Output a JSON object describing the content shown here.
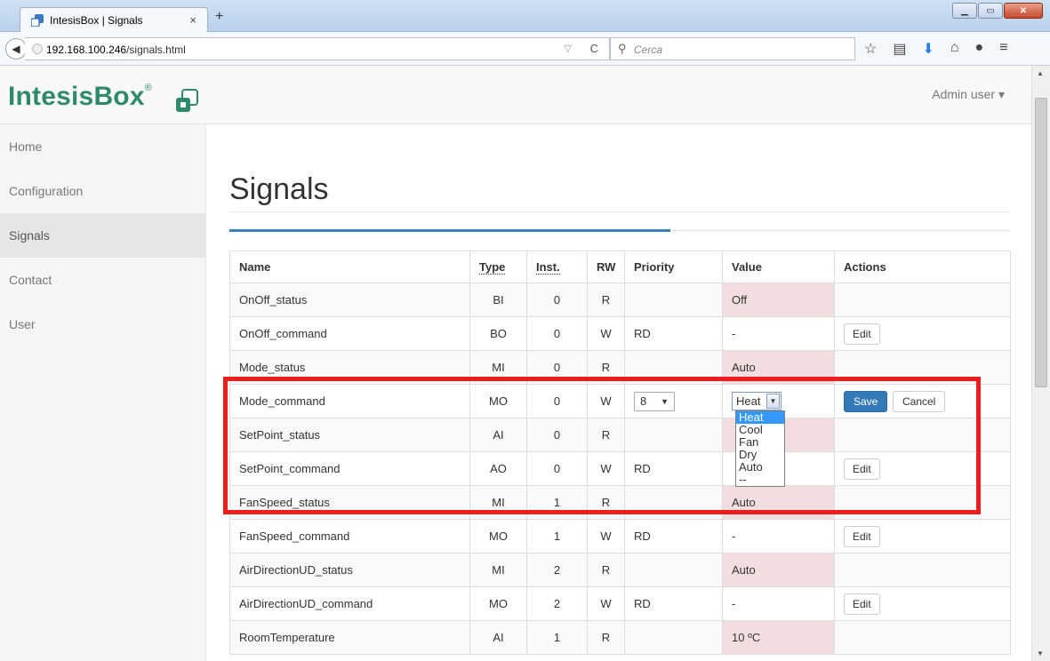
{
  "browser": {
    "tab_title": "IntesisBox | Signals",
    "tab_close": "×",
    "new_tab": "+",
    "url_host": "192.168.100.246",
    "url_path": "/signals.html",
    "search_placeholder": "Cerca"
  },
  "app": {
    "brand": "IntesisBox",
    "brand_mark": "®",
    "user_menu": "Admin user ▾",
    "page_title": "Signals",
    "accent_color": "#337ab7",
    "brand_color": "#2f8a6b"
  },
  "sidebar": {
    "items": [
      {
        "label": "Home"
      },
      {
        "label": "Configuration"
      },
      {
        "label": "Signals"
      },
      {
        "label": "Contact"
      },
      {
        "label": "User"
      }
    ],
    "active": "Signals"
  },
  "table": {
    "headers": {
      "name": "Name",
      "type": "Type",
      "inst": "Inst.",
      "rw": "RW",
      "priority": "Priority",
      "value": "Value",
      "actions": "Actions"
    },
    "rows": [
      {
        "name": "OnOff_status",
        "type": "BI",
        "inst": "0",
        "rw": "R",
        "priority": "",
        "value": "Off"
      },
      {
        "name": "OnOff_command",
        "type": "BO",
        "inst": "0",
        "rw": "W",
        "priority": "RD",
        "value": "-",
        "action": "Edit"
      },
      {
        "name": "Mode_status",
        "type": "MI",
        "inst": "0",
        "rw": "R",
        "priority": "",
        "value": "Auto"
      },
      {
        "name": "Mode_command",
        "type": "MO",
        "inst": "0",
        "rw": "W",
        "priority": "8",
        "value": "Heat",
        "save": "Save",
        "cancel": "Cancel"
      },
      {
        "name": "SetPoint_status",
        "type": "AI",
        "inst": "0",
        "rw": "R",
        "priority": "",
        "value": ""
      },
      {
        "name": "SetPoint_command",
        "type": "AO",
        "inst": "0",
        "rw": "W",
        "priority": "RD",
        "value": "",
        "action": "Edit"
      },
      {
        "name": "FanSpeed_status",
        "type": "MI",
        "inst": "1",
        "rw": "R",
        "priority": "",
        "value": "Auto"
      },
      {
        "name": "FanSpeed_command",
        "type": "MO",
        "inst": "1",
        "rw": "W",
        "priority": "RD",
        "value": "-",
        "action": "Edit"
      },
      {
        "name": "AirDirectionUD_status",
        "type": "MI",
        "inst": "2",
        "rw": "R",
        "priority": "",
        "value": "Auto"
      },
      {
        "name": "AirDirectionUD_command",
        "type": "MO",
        "inst": "2",
        "rw": "W",
        "priority": "RD",
        "value": "-",
        "action": "Edit"
      },
      {
        "name": "RoomTemperature",
        "type": "AI",
        "inst": "1",
        "rw": "R",
        "priority": "",
        "value": "10 ºC"
      }
    ]
  },
  "mode_dropdown": {
    "options": [
      "Heat",
      "Cool",
      "Fan",
      "Dry",
      "Auto",
      "--"
    ],
    "selected": "Heat"
  }
}
